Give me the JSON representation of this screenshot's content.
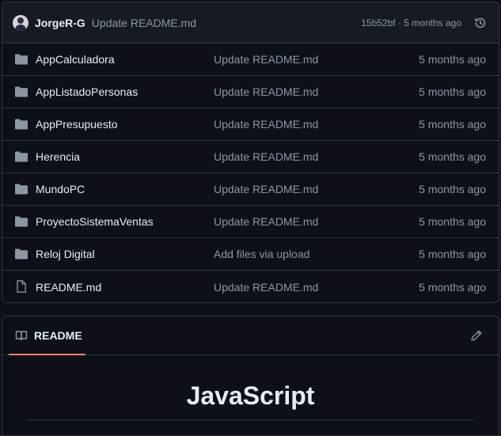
{
  "commit": {
    "author": "JorgeR-G",
    "message": "Update README.md",
    "meta": "15b52bf · 5 months ago"
  },
  "files": [
    {
      "name": "AppCalculadora",
      "type": "folder",
      "commit": "Update README.md",
      "age": "5 months ago"
    },
    {
      "name": "AppListadoPersonas",
      "type": "folder",
      "commit": "Update README.md",
      "age": "5 months ago"
    },
    {
      "name": "AppPresupuesto",
      "type": "folder",
      "commit": "Update README.md",
      "age": "5 months ago"
    },
    {
      "name": "Herencia",
      "type": "folder",
      "commit": "Update README.md",
      "age": "5 months ago"
    },
    {
      "name": "MundoPC",
      "type": "folder",
      "commit": "Update README.md",
      "age": "5 months ago"
    },
    {
      "name": "ProyectoSistemaVentas",
      "type": "folder",
      "commit": "Update README.md",
      "age": "5 months ago"
    },
    {
      "name": "Reloj Digital",
      "type": "folder",
      "commit": "Add files via upload",
      "age": "5 months ago"
    },
    {
      "name": "README.md",
      "type": "file",
      "commit": "Update README.md",
      "age": "5 months ago"
    }
  ],
  "readme": {
    "tab_label": "README",
    "heading": "JavaScript"
  },
  "icons": {
    "folder": "folder-icon",
    "file": "file-icon",
    "history": "history-icon",
    "book": "book-icon",
    "edit": "pencil-icon"
  },
  "colors": {
    "background": "#0d1117",
    "header_bg": "#161b22",
    "border": "#30363d",
    "muted_text": "#8d96a0",
    "tab_underline": "#f78166"
  }
}
